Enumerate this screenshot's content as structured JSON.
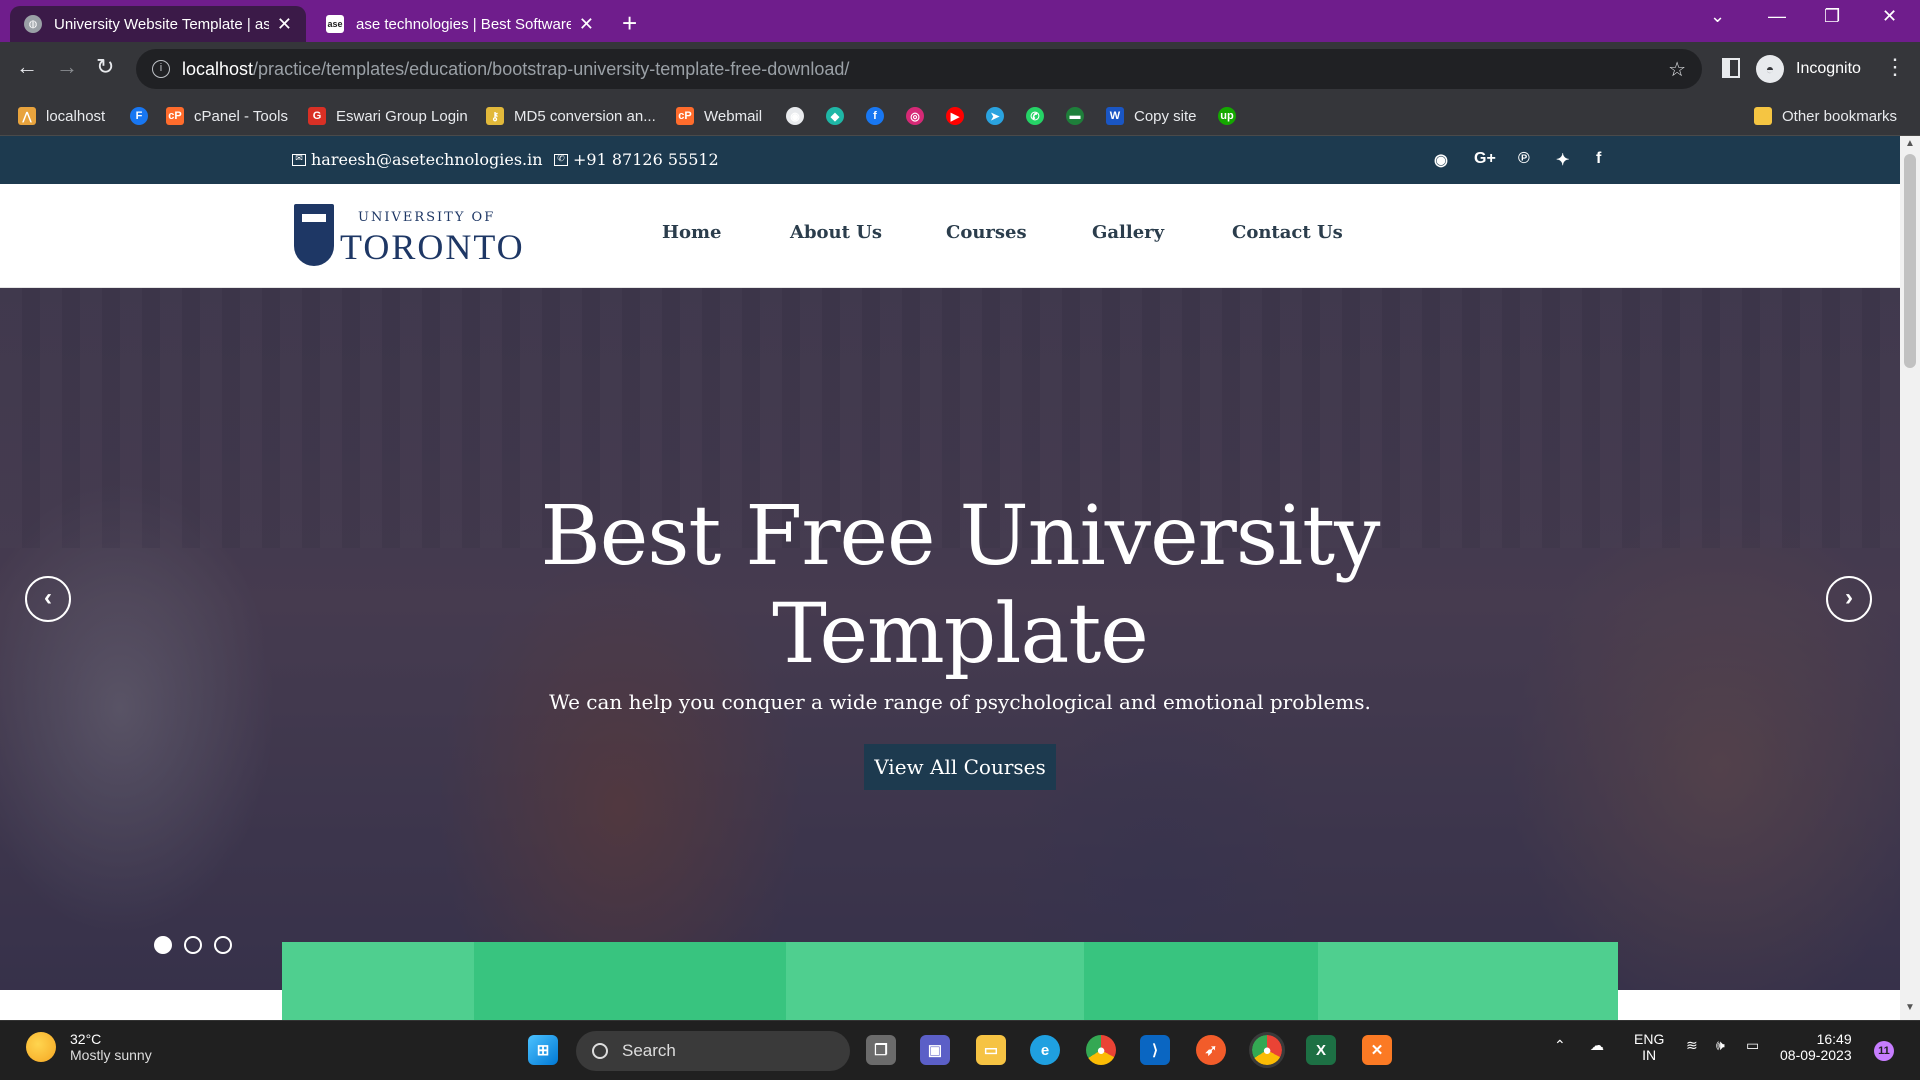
{
  "browser": {
    "tabs": [
      {
        "title": "University Website Template | ase",
        "active": true
      },
      {
        "title": "ase technologies | Best Software",
        "active": false,
        "favicon_text": "ase"
      }
    ],
    "url_host": "localhost",
    "url_path": "/practice/templates/education/bootstrap-university-template-free-download/",
    "profile_label": "Incognito",
    "bookmarks": [
      {
        "label": "localhost",
        "icon": "xampp-icon",
        "color": "#e8a33d",
        "glyph": "⋀"
      },
      {
        "label": "",
        "icon": "f-icon",
        "color": "#1877f2",
        "glyph": "F"
      },
      {
        "label": "cPanel - Tools",
        "icon": "cpanel-icon",
        "color": "#ff6c2c",
        "glyph": "cP"
      },
      {
        "label": "Eswari Group Login",
        "icon": "eswari-icon",
        "color": "#d93025",
        "glyph": "G"
      },
      {
        "label": "MD5 conversion an...",
        "icon": "key-icon",
        "color": "#e2b93b",
        "glyph": "⚷"
      },
      {
        "label": "Webmail",
        "icon": "cpanel-icon",
        "color": "#ff6c2c",
        "glyph": "cP"
      },
      {
        "label": "",
        "icon": "github-icon",
        "color": "#e8eaed",
        "glyph": "◉"
      },
      {
        "label": "",
        "icon": "diamond-icon",
        "color": "#1fb7a6",
        "glyph": "◆"
      },
      {
        "label": "",
        "icon": "facebook-icon",
        "color": "#1877f2",
        "glyph": "f"
      },
      {
        "label": "",
        "icon": "instagram-icon",
        "color": "#d62976",
        "glyph": "◎"
      },
      {
        "label": "",
        "icon": "youtube-icon",
        "color": "#ff0000",
        "glyph": "▶"
      },
      {
        "label": "",
        "icon": "telegram-icon",
        "color": "#2aa3df",
        "glyph": "➤"
      },
      {
        "label": "",
        "icon": "whatsapp-icon",
        "color": "#25d366",
        "glyph": "✆"
      },
      {
        "label": "",
        "icon": "folder-icon",
        "color": "#1e7f3a",
        "glyph": "▬"
      },
      {
        "label": "Copy site",
        "icon": "w-icon",
        "color": "#1a56c4",
        "glyph": "W"
      },
      {
        "label": "",
        "icon": "upwork-icon",
        "color": "#14a800",
        "glyph": "up"
      }
    ],
    "other_bookmarks": "Other bookmarks"
  },
  "site": {
    "topbar": {
      "email": "hareesh@asetechnologies.in",
      "phone": "+91 87126 55512",
      "social": [
        "github-icon",
        "google-plus-icon",
        "pinterest-icon",
        "twitter-icon",
        "facebook-icon"
      ],
      "social_glyphs": [
        "◉",
        "G+",
        "℗",
        "✦",
        "f"
      ]
    },
    "logo": {
      "line1": "UNIVERSITY OF",
      "line2": "TORONTO"
    },
    "nav": [
      "Home",
      "About Us",
      "Courses",
      "Gallery",
      "Contact Us"
    ],
    "hero": {
      "title": "Best Free University Template",
      "subtitle": "We can help you conquer a wide range of psychological and emotional problems.",
      "button": "View All Courses",
      "slides": 3,
      "active_slide": 1
    },
    "card_colors": [
      "#4fcf8f",
      "#38c47f",
      "#4fcf8f",
      "#38c47f",
      "#4fcf8f"
    ]
  },
  "taskbar": {
    "weather_temp": "32°C",
    "weather_desc": "Mostly sunny",
    "search_placeholder": "Search",
    "lang1": "ENG",
    "lang2": "IN",
    "time": "16:49",
    "date": "08-09-2023",
    "notifications": "11"
  },
  "colors": {
    "brand_dark": "#1d3a4f",
    "tab_bar": "#6f1d8c"
  }
}
